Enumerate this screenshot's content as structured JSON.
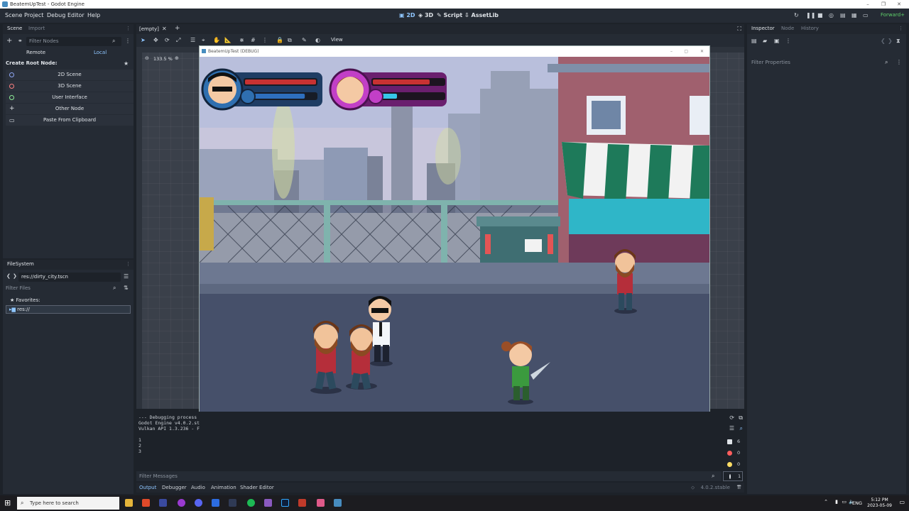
{
  "window": {
    "title": "BeatemUpTest - Godot Engine"
  },
  "menu": {
    "items": [
      "Scene",
      "Project",
      "Debug",
      "Editor",
      "Help"
    ]
  },
  "workspaces": {
    "w2d": "2D",
    "w3d": "3D",
    "script": "Script",
    "assetlib": "AssetLib"
  },
  "renderer": "Forward+",
  "scene_dock": {
    "tabs": [
      "Scene",
      "Import"
    ],
    "filter_placeholder": "Filter Nodes",
    "remote": "Remote",
    "local": "Local",
    "create_root": "Create Root Node:",
    "buttons": [
      "2D Scene",
      "3D Scene",
      "User Interface",
      "Other Node",
      "Paste From Clipboard"
    ]
  },
  "filesystem": {
    "tab": "FileSystem",
    "path": "res://dirty_city.tscn",
    "filter_placeholder": "Filter Files",
    "favorites": "Favorites:",
    "root": "res://"
  },
  "editor": {
    "tab": "[empty]",
    "view_menu": "View",
    "zoom": "133.5 %"
  },
  "game_window": {
    "title": "BeatemUpTest (DEBUG)"
  },
  "output": {
    "lines": [
      "--- Debugging process",
      "Godot Engine v4.0.2.st",
      "Vulkan API 1.3.236 - F",
      "",
      "1",
      "2",
      "3"
    ],
    "filter_placeholder": "Filter Messages",
    "tabs": [
      "Output",
      "Debugger",
      "Audio",
      "Animation",
      "Shader Editor"
    ],
    "version": "4.0.2.stable",
    "counters": {
      "messages": "6",
      "errors": "0",
      "warnings": "0",
      "info": "1"
    }
  },
  "inspector": {
    "tabs": [
      "Inspector",
      "Node",
      "History"
    ],
    "filter_placeholder": "Filter Properties"
  },
  "taskbar": {
    "search_placeholder": "Type here to search",
    "lang": "ENG",
    "time": "5:12 PM",
    "date": "2023-05-09"
  },
  "game_hud": {
    "player1": {
      "health": 1.0,
      "energy": 0.82,
      "color": "#2f6fb0"
    },
    "player2": {
      "health": 0.8,
      "energy": 0.25,
      "color": "#c23fc7"
    }
  }
}
